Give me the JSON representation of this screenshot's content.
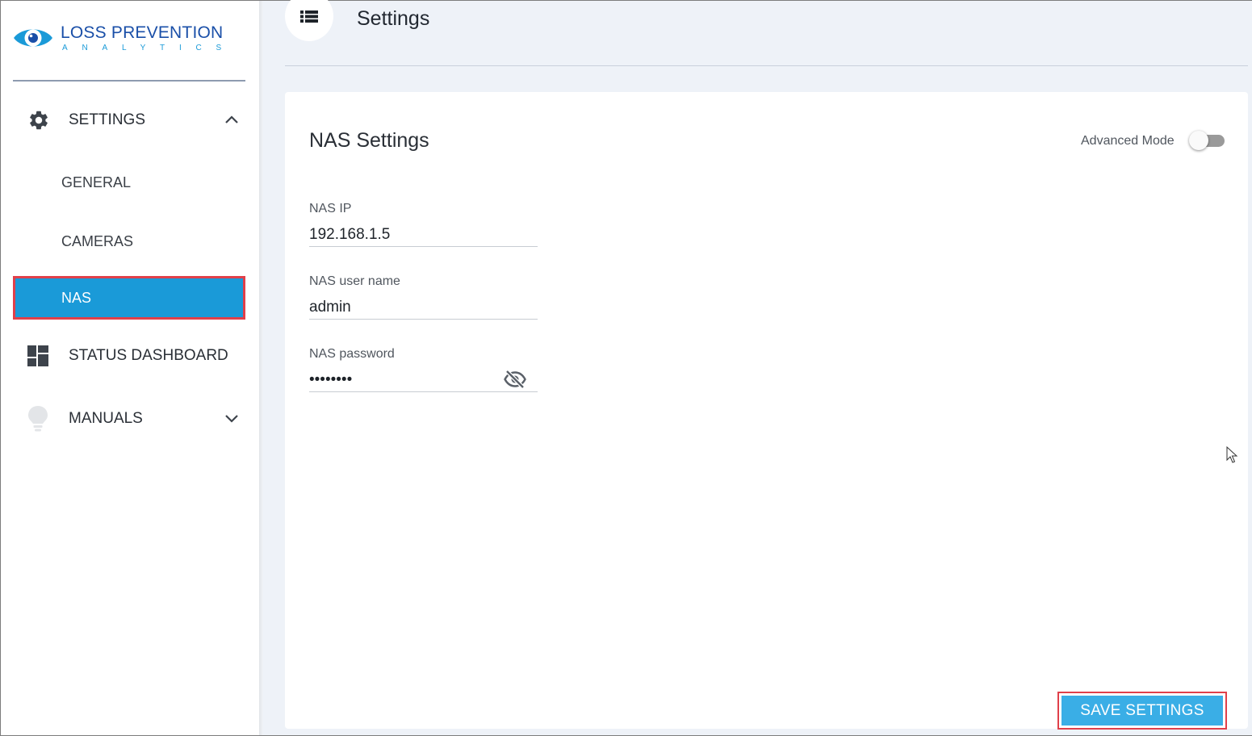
{
  "brand": {
    "title": "LOSS PREVENTION",
    "subtitle": "ANALYTICS",
    "primary_color": "#1a4fa8",
    "accent_color": "#1a9ad8"
  },
  "sidebar": {
    "settings": {
      "label": "SETTINGS",
      "icon": "gear-icon",
      "expanded": true
    },
    "sub_items": [
      {
        "label": "GENERAL"
      },
      {
        "label": "CAMERAS"
      },
      {
        "label": "NAS",
        "active": true
      }
    ],
    "status_dashboard": {
      "label": "STATUS DASHBOARD",
      "icon": "dashboard-icon"
    },
    "manuals": {
      "label": "MANUALS",
      "icon": "lightbulb-icon",
      "expanded": false
    }
  },
  "header": {
    "title": "Settings",
    "icon": "list-icon"
  },
  "card": {
    "title": "NAS Settings",
    "advanced_mode": {
      "label": "Advanced Mode",
      "enabled": false
    },
    "fields": {
      "nas_ip": {
        "label": "NAS IP",
        "value": "192.168.1.5"
      },
      "nas_user": {
        "label": "NAS user name",
        "value": "admin"
      },
      "nas_password": {
        "label": "NAS password",
        "value": "password"
      }
    },
    "save_label": "SAVE SETTINGS"
  },
  "colors": {
    "active_item": "#1a9ad8",
    "highlight_border": "#e0404a",
    "save_button": "#3aaee6"
  }
}
